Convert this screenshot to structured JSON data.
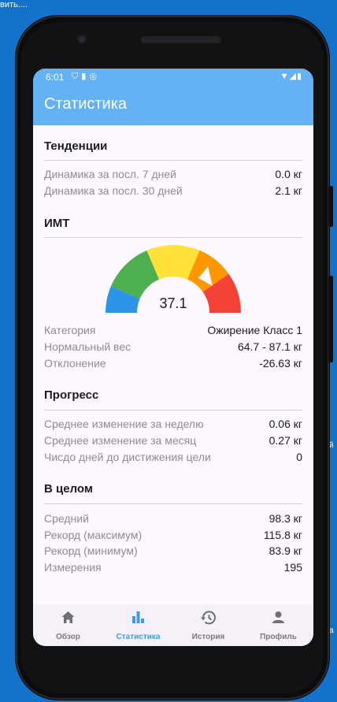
{
  "desktop": {
    "corner_text": "вить....",
    "edge_text_a": "й",
    "edge_text_b": "а"
  },
  "status_bar": {
    "time": "6:01",
    "left_icons": [
      "shield-icon",
      "sim-card-icon",
      "sync-icon"
    ],
    "right_icons": [
      "wifi-icon",
      "signal-icon",
      "battery-icon"
    ]
  },
  "appbar": {
    "title": "Статистика"
  },
  "trends": {
    "title": "Тенденции",
    "rows": [
      {
        "label": "Динамика за посл. 7 дней",
        "value": "0.0 кг"
      },
      {
        "label": "Динамика за посл. 30 дней",
        "value": "2.1 кг"
      }
    ]
  },
  "bmi": {
    "title": "ИМТ",
    "value": "37.1",
    "gauge_colors": [
      "#2c95e8",
      "#4caf50",
      "#ffe13a",
      "#ff9800",
      "#f44336"
    ],
    "rows": [
      {
        "label": "Категория",
        "value": "Ожирение Класс 1"
      },
      {
        "label": "Нормальный вес",
        "value": "64.7 - 87.1 кг"
      },
      {
        "label": "Отклонение",
        "value": "-26.63 кг"
      }
    ]
  },
  "progress": {
    "title": "Прогресс",
    "rows": [
      {
        "label": "Среднее изменение за неделю",
        "value": "0.06 кг"
      },
      {
        "label": "Среднее изменение за месяц",
        "value": "0.27 кг"
      },
      {
        "label": "Чисдо дней до дистижения цели",
        "value": "0"
      }
    ]
  },
  "overall": {
    "title": "В целом",
    "rows": [
      {
        "label": "Средний",
        "value": "98.3 кг"
      },
      {
        "label": "Рекорд (максимум)",
        "value": "115.8 кг"
      },
      {
        "label": "Рекорд (минимум)",
        "value": "83.9 кг"
      },
      {
        "label": "Измерения",
        "value": "195"
      }
    ]
  },
  "nav": {
    "items": [
      {
        "label": "Обзор",
        "icon": "home-icon"
      },
      {
        "label": "Статистика",
        "icon": "bar-chart-icon",
        "active": true
      },
      {
        "label": "История",
        "icon": "history-icon"
      },
      {
        "label": "Профиль",
        "icon": "profile-icon"
      }
    ]
  }
}
